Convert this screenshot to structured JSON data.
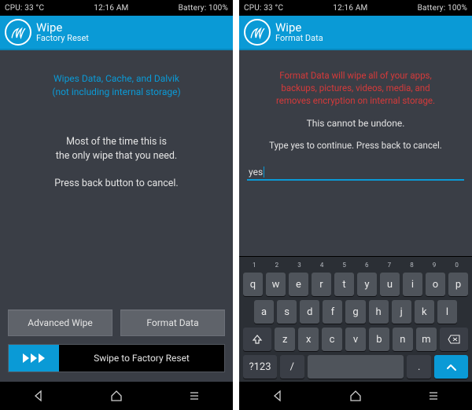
{
  "left": {
    "status": {
      "cpu": "CPU: 33 °C",
      "time": "12:16 AM",
      "batt": "Battery: 100%"
    },
    "header": {
      "title": "Wipe",
      "subtitle": "Factory Reset"
    },
    "info_l1": "Wipes Data, Cache, and Dalvik",
    "info_l2": "(not including internal storage)",
    "msg_l1": "Most of the time this is",
    "msg_l2": "the only wipe that you need.",
    "msg_l3": "Press back button to cancel.",
    "btn_adv": "Advanced Wipe",
    "btn_fmt": "Format Data",
    "swipe": "Swipe to Factory Reset"
  },
  "right": {
    "status": {
      "cpu": "CPU: 33 °C",
      "time": "12:16 AM",
      "batt": "Battery: 100%"
    },
    "header": {
      "title": "Wipe",
      "subtitle": "Format Data"
    },
    "warn_l1": "Format Data will wipe all of your apps,",
    "warn_l2": "backups, pictures, videos, media, and",
    "warn_l3": "removes encryption on internal storage.",
    "undone": "This cannot be undone.",
    "instr": "Type yes to continue.  Press back to cancel.",
    "input_value": "yes",
    "keyboard": {
      "nums": [
        "1",
        "2",
        "3",
        "4",
        "5",
        "6",
        "7",
        "8",
        "9",
        "0"
      ],
      "row1": [
        "q",
        "w",
        "e",
        "r",
        "t",
        "y",
        "u",
        "i",
        "o",
        "p"
      ],
      "row2": [
        "a",
        "s",
        "d",
        "f",
        "g",
        "h",
        "j",
        "k",
        "l"
      ],
      "row3": [
        "z",
        "x",
        "c",
        "v",
        "b",
        "n",
        "m"
      ],
      "symkey": "?123",
      "slash": "/",
      "dot": "."
    }
  }
}
